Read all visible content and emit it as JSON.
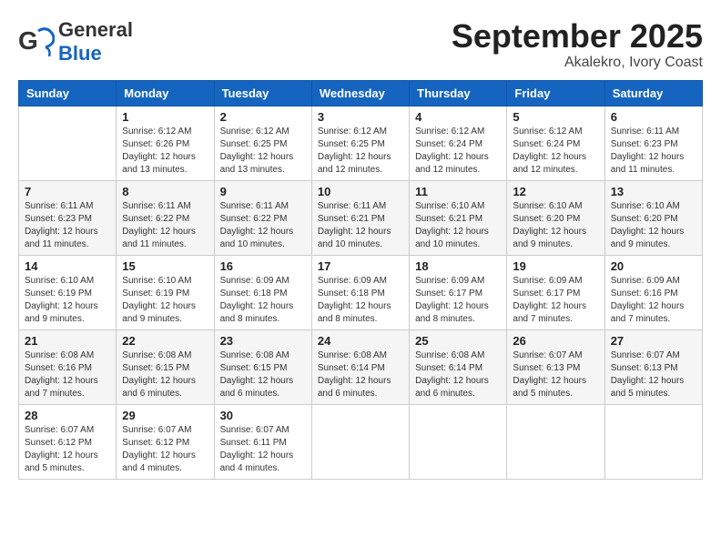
{
  "logo": {
    "general": "General",
    "blue": "Blue"
  },
  "title": "September 2025",
  "subtitle": "Akalekro, Ivory Coast",
  "days": [
    "Sunday",
    "Monday",
    "Tuesday",
    "Wednesday",
    "Thursday",
    "Friday",
    "Saturday"
  ],
  "weeks": [
    [
      {
        "day": "",
        "info": ""
      },
      {
        "day": "1",
        "info": "Sunrise: 6:12 AM\nSunset: 6:26 PM\nDaylight: 12 hours\nand 13 minutes."
      },
      {
        "day": "2",
        "info": "Sunrise: 6:12 AM\nSunset: 6:25 PM\nDaylight: 12 hours\nand 13 minutes."
      },
      {
        "day": "3",
        "info": "Sunrise: 6:12 AM\nSunset: 6:25 PM\nDaylight: 12 hours\nand 12 minutes."
      },
      {
        "day": "4",
        "info": "Sunrise: 6:12 AM\nSunset: 6:24 PM\nDaylight: 12 hours\nand 12 minutes."
      },
      {
        "day": "5",
        "info": "Sunrise: 6:12 AM\nSunset: 6:24 PM\nDaylight: 12 hours\nand 12 minutes."
      },
      {
        "day": "6",
        "info": "Sunrise: 6:11 AM\nSunset: 6:23 PM\nDaylight: 12 hours\nand 11 minutes."
      }
    ],
    [
      {
        "day": "7",
        "info": "Sunrise: 6:11 AM\nSunset: 6:23 PM\nDaylight: 12 hours\nand 11 minutes."
      },
      {
        "day": "8",
        "info": "Sunrise: 6:11 AM\nSunset: 6:22 PM\nDaylight: 12 hours\nand 11 minutes."
      },
      {
        "day": "9",
        "info": "Sunrise: 6:11 AM\nSunset: 6:22 PM\nDaylight: 12 hours\nand 10 minutes."
      },
      {
        "day": "10",
        "info": "Sunrise: 6:11 AM\nSunset: 6:21 PM\nDaylight: 12 hours\nand 10 minutes."
      },
      {
        "day": "11",
        "info": "Sunrise: 6:10 AM\nSunset: 6:21 PM\nDaylight: 12 hours\nand 10 minutes."
      },
      {
        "day": "12",
        "info": "Sunrise: 6:10 AM\nSunset: 6:20 PM\nDaylight: 12 hours\nand 9 minutes."
      },
      {
        "day": "13",
        "info": "Sunrise: 6:10 AM\nSunset: 6:20 PM\nDaylight: 12 hours\nand 9 minutes."
      }
    ],
    [
      {
        "day": "14",
        "info": "Sunrise: 6:10 AM\nSunset: 6:19 PM\nDaylight: 12 hours\nand 9 minutes."
      },
      {
        "day": "15",
        "info": "Sunrise: 6:10 AM\nSunset: 6:19 PM\nDaylight: 12 hours\nand 9 minutes."
      },
      {
        "day": "16",
        "info": "Sunrise: 6:09 AM\nSunset: 6:18 PM\nDaylight: 12 hours\nand 8 minutes."
      },
      {
        "day": "17",
        "info": "Sunrise: 6:09 AM\nSunset: 6:18 PM\nDaylight: 12 hours\nand 8 minutes."
      },
      {
        "day": "18",
        "info": "Sunrise: 6:09 AM\nSunset: 6:17 PM\nDaylight: 12 hours\nand 8 minutes."
      },
      {
        "day": "19",
        "info": "Sunrise: 6:09 AM\nSunset: 6:17 PM\nDaylight: 12 hours\nand 7 minutes."
      },
      {
        "day": "20",
        "info": "Sunrise: 6:09 AM\nSunset: 6:16 PM\nDaylight: 12 hours\nand 7 minutes."
      }
    ],
    [
      {
        "day": "21",
        "info": "Sunrise: 6:08 AM\nSunset: 6:16 PM\nDaylight: 12 hours\nand 7 minutes."
      },
      {
        "day": "22",
        "info": "Sunrise: 6:08 AM\nSunset: 6:15 PM\nDaylight: 12 hours\nand 6 minutes."
      },
      {
        "day": "23",
        "info": "Sunrise: 6:08 AM\nSunset: 6:15 PM\nDaylight: 12 hours\nand 6 minutes."
      },
      {
        "day": "24",
        "info": "Sunrise: 6:08 AM\nSunset: 6:14 PM\nDaylight: 12 hours\nand 6 minutes."
      },
      {
        "day": "25",
        "info": "Sunrise: 6:08 AM\nSunset: 6:14 PM\nDaylight: 12 hours\nand 6 minutes."
      },
      {
        "day": "26",
        "info": "Sunrise: 6:07 AM\nSunset: 6:13 PM\nDaylight: 12 hours\nand 5 minutes."
      },
      {
        "day": "27",
        "info": "Sunrise: 6:07 AM\nSunset: 6:13 PM\nDaylight: 12 hours\nand 5 minutes."
      }
    ],
    [
      {
        "day": "28",
        "info": "Sunrise: 6:07 AM\nSunset: 6:12 PM\nDaylight: 12 hours\nand 5 minutes."
      },
      {
        "day": "29",
        "info": "Sunrise: 6:07 AM\nSunset: 6:12 PM\nDaylight: 12 hours\nand 4 minutes."
      },
      {
        "day": "30",
        "info": "Sunrise: 6:07 AM\nSunset: 6:11 PM\nDaylight: 12 hours\nand 4 minutes."
      },
      {
        "day": "",
        "info": ""
      },
      {
        "day": "",
        "info": ""
      },
      {
        "day": "",
        "info": ""
      },
      {
        "day": "",
        "info": ""
      }
    ]
  ]
}
